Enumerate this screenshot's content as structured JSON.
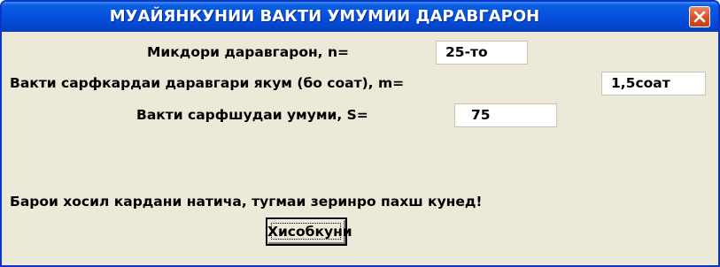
{
  "window": {
    "title": "МУАЙЯНКУНИИ ВАКТИ УМУМИИ ДАРАВГАРОН",
    "close_icon": "close-icon"
  },
  "form": {
    "n_label": "Микдори даравгарон, n=",
    "n_value": "25-то",
    "m_label": "Вакти сарфкардаи даравгари якум (бо соат), m=",
    "m_value": "1,5соат",
    "s_label": "Вакти сарфшудаи умуми, S=",
    "s_value": "75",
    "instruction": "Барои хосил кардани натича, тугмаи зеринро пахш кунед!",
    "calc_button": "Хисобкуни"
  },
  "colors": {
    "titlebar": "#0552df",
    "close_button": "#d9542c",
    "client_background": "#ece9d8"
  }
}
